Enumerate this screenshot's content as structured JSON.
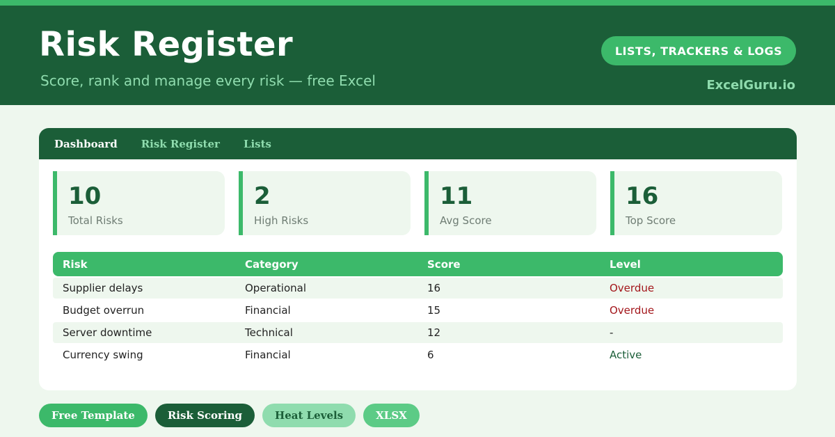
{
  "header": {
    "title": "Risk Register",
    "subtitle": "Score, rank and manage every risk — free Excel",
    "category_label": "LISTS, TRACKERS & LOGS",
    "brand": "ExcelGuru.io"
  },
  "tabs": [
    {
      "label": "Dashboard",
      "active": true
    },
    {
      "label": "Risk Register",
      "active": false
    },
    {
      "label": "Lists",
      "active": false
    }
  ],
  "kpis": [
    {
      "value": "10",
      "label": "Total Risks"
    },
    {
      "value": "2",
      "label": "High Risks"
    },
    {
      "value": "11",
      "label": "Avg Score"
    },
    {
      "value": "16",
      "label": "Top Score"
    }
  ],
  "table": {
    "columns": [
      "Risk",
      "Category",
      "Score",
      "Level"
    ],
    "rows": [
      {
        "risk": "Supplier delays",
        "category": "Operational",
        "score": "16",
        "level": "Overdue"
      },
      {
        "risk": "Budget overrun",
        "category": "Financial",
        "score": "15",
        "level": "Overdue"
      },
      {
        "risk": "Server downtime",
        "category": "Technical",
        "score": "12",
        "level": "-"
      },
      {
        "risk": "Currency swing",
        "category": "Financial",
        "score": "6",
        "level": "Active"
      }
    ]
  },
  "tags": [
    "Free Template",
    "Risk Scoring",
    "Heat Levels",
    "XLSX"
  ],
  "colors": {
    "dark_green": "#1b5e38",
    "accent_green": "#3cb96a",
    "light_green": "#8fdcae",
    "background": "#eef7ee",
    "overdue_red": "#a3161b"
  }
}
